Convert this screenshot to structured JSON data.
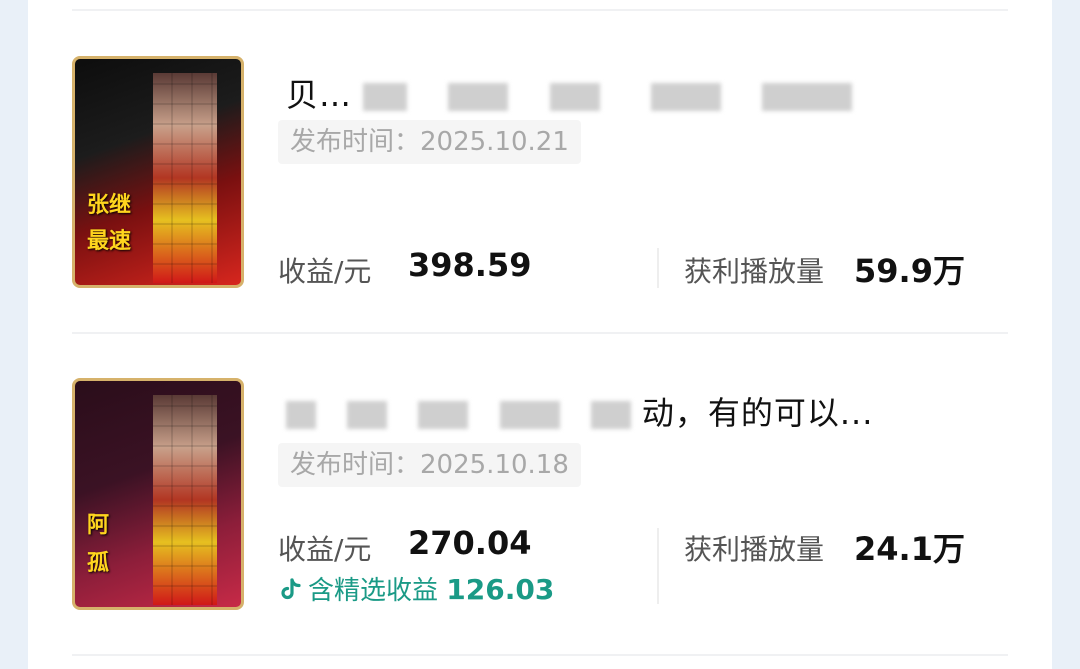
{
  "cards": [
    {
      "thumb_caption": [
        "张继",
        "最速"
      ],
      "title": "贝…",
      "publish_label": "发布时间：",
      "publish_date": "2025.10.21",
      "revenue_label": "收益/元",
      "revenue_value": "398.59",
      "plays_label": "获利播放量",
      "plays_value": "59.9万"
    },
    {
      "thumb_caption": [
        "阿",
        "孤"
      ],
      "title_tail": "动，有的可以...",
      "publish_label": "发布时间：",
      "publish_date": "2025.10.18",
      "revenue_label": "收益/元",
      "revenue_value": "270.04",
      "featured_label": "含精选收益",
      "featured_value": "126.03",
      "plays_label": "获利播放量",
      "plays_value": "24.1万"
    }
  ],
  "colors": {
    "accent_teal": "#1a9a86",
    "thumb_border_gold": "#d6b26b"
  },
  "icons": {
    "featured_icon": "douyin-music-note-icon"
  }
}
